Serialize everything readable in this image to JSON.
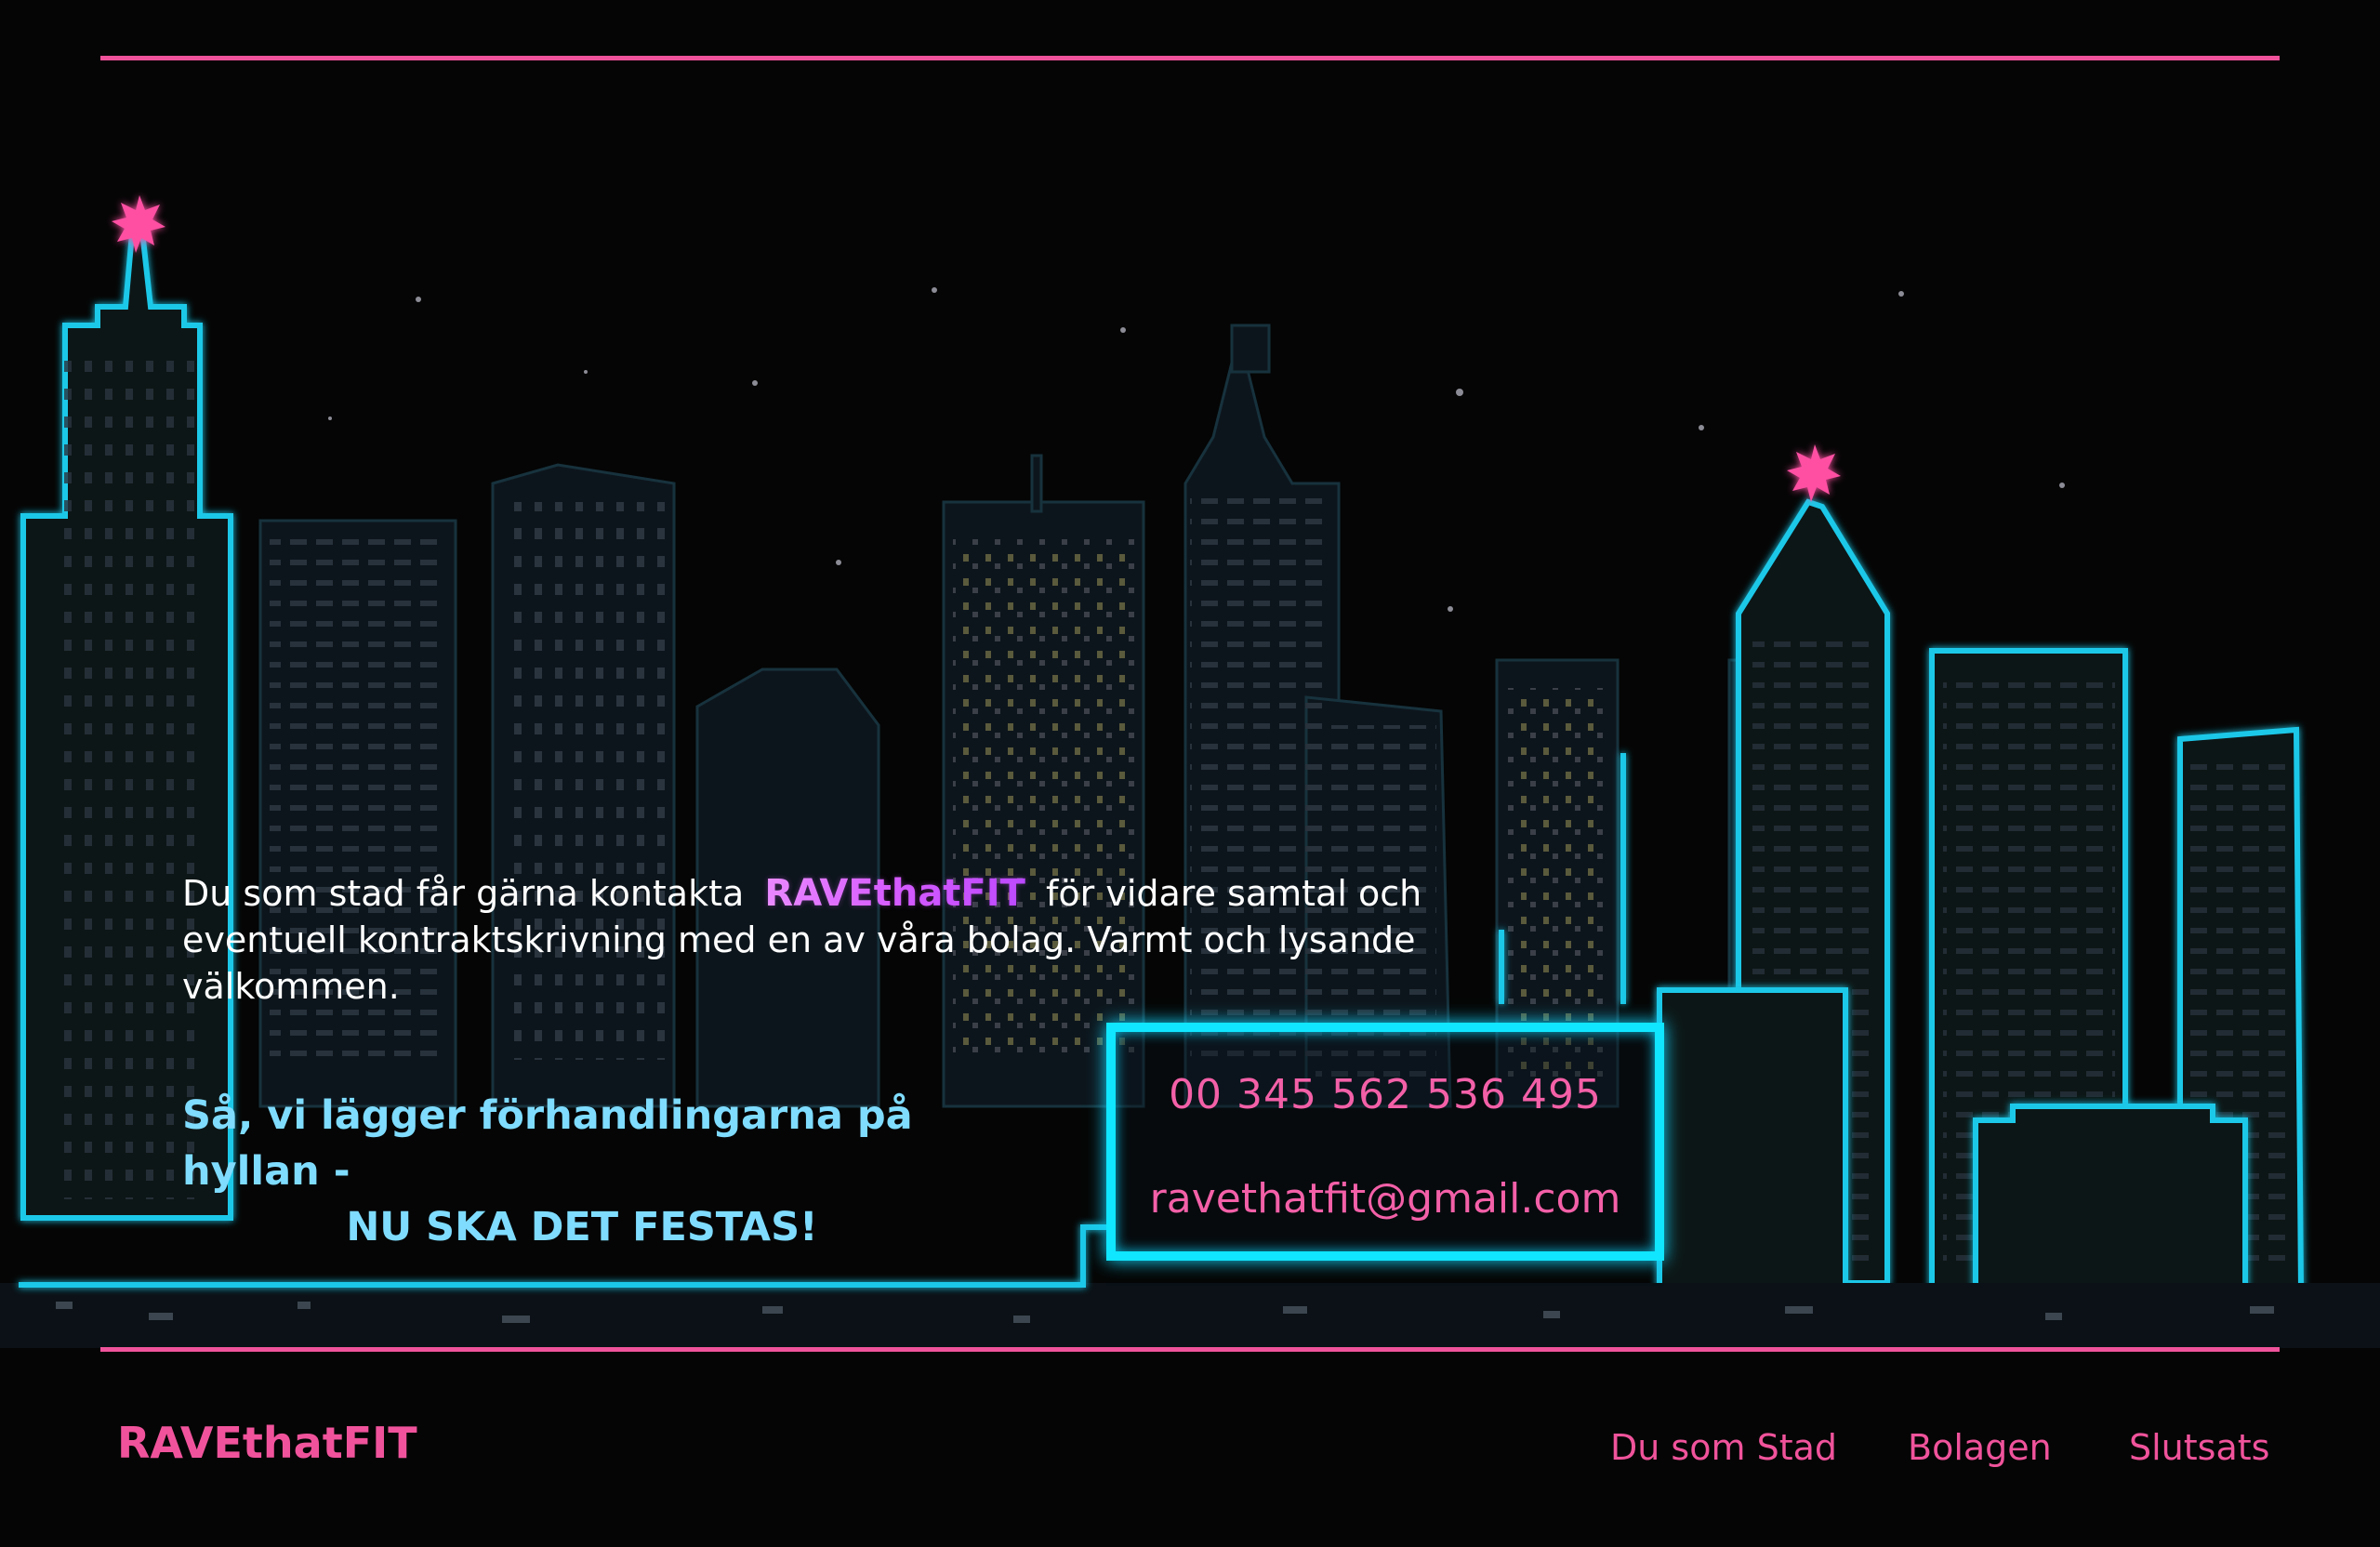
{
  "intro": {
    "before": "Du som stad får gärna kontakta",
    "brand": "RAVEthatFIT",
    "after": "för vidare samtal och eventuell kontraktskrivning med en av våra bolag. Varmt och lysande välkommen."
  },
  "cta": {
    "line1": "Så, vi lägger förhandlingarna på hyllan -",
    "line2": "NU SKA DET FESTAS!"
  },
  "contact": {
    "phone": "00 345 562 536 495",
    "email": "ravethatfit@gmail.com"
  },
  "footer": {
    "brand": "RAVEthatFIT",
    "nav": [
      "Du som Stad",
      "Bolagen",
      "Slutsats"
    ]
  },
  "colors": {
    "accent_pink": "#f0539b",
    "neon_cyan": "#10e6ff",
    "background": "#050505"
  }
}
